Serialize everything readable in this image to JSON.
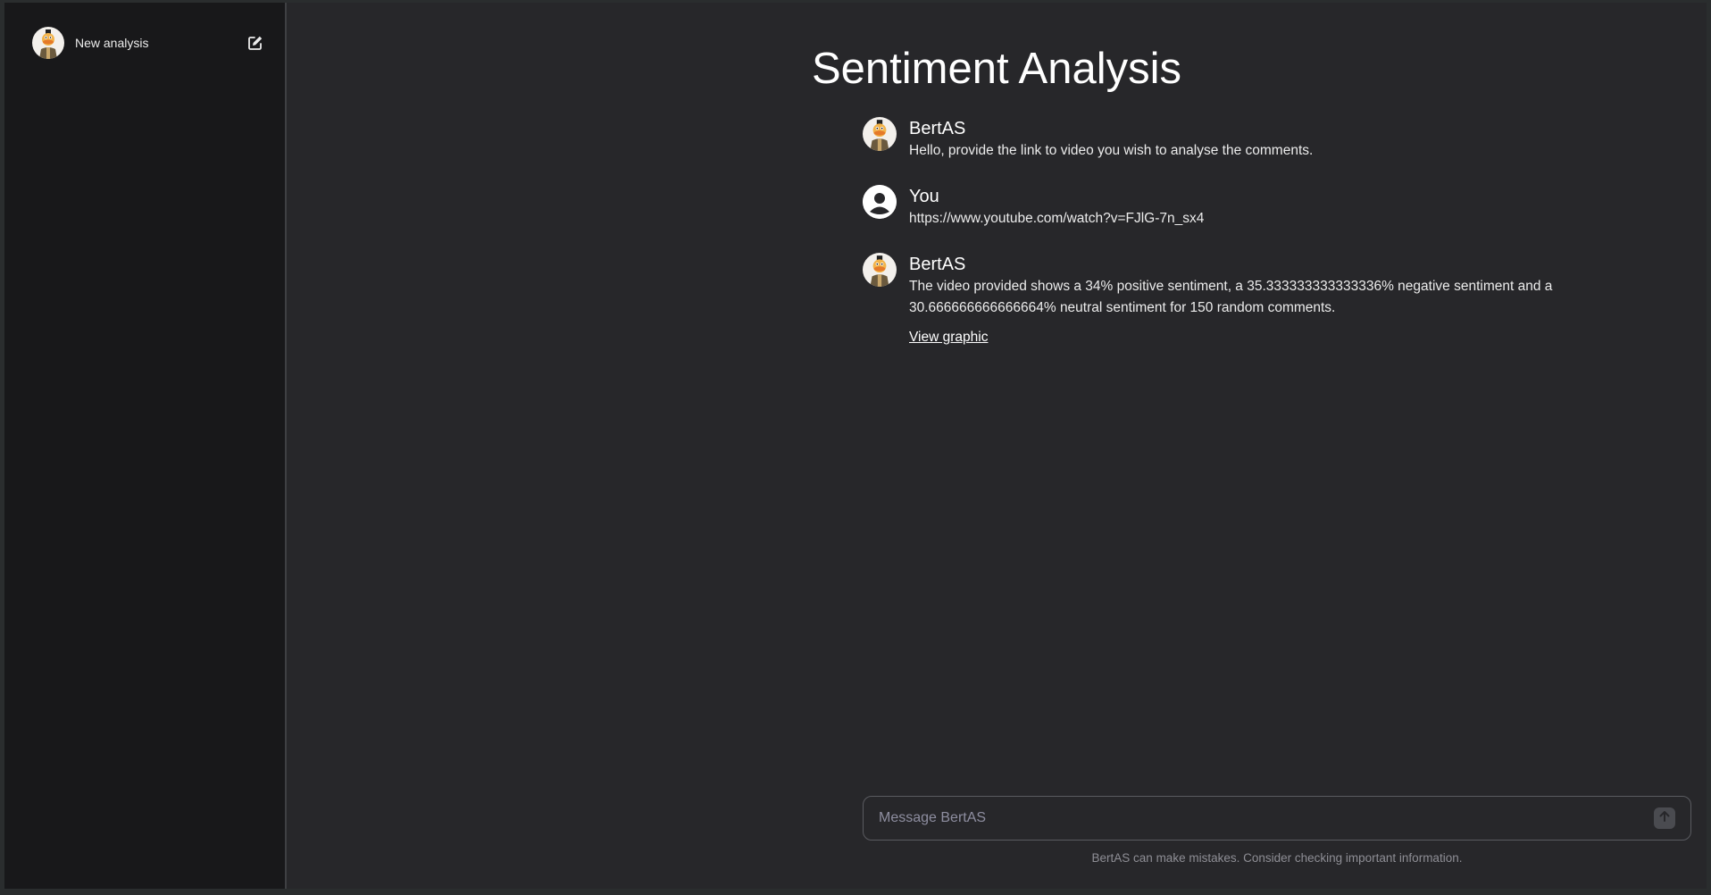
{
  "sidebar": {
    "new_label": "New analysis"
  },
  "main": {
    "title": "Sentiment Analysis",
    "messages": [
      {
        "sender": "BertAS",
        "text": "Hello, provide the link to video you wish to analyse the comments."
      },
      {
        "sender": "You",
        "text": "https://www.youtube.com/watch?v=FJlG-7n_sx4"
      },
      {
        "sender": "BertAS",
        "text_line1": "The video provided shows a 34% positive sentiment, a 35.333333333333336% negative sentiment and a",
        "text_line2": "30.666666666666664% neutral sentiment for 150 random comments.",
        "link": "View graphic"
      }
    ],
    "input": {
      "placeholder": "Message BertAS"
    },
    "disclaimer": "BertAS can make mistakes. Consider checking important information."
  },
  "icons": {
    "bot_avatar": "bert-avatar-icon",
    "user_avatar": "user-circle-icon",
    "edit": "edit-icon",
    "send": "arrow-up-icon"
  },
  "colors": {
    "sidebar_bg": "#18181a",
    "main_bg": "#27272a",
    "text": "#ececec"
  }
}
